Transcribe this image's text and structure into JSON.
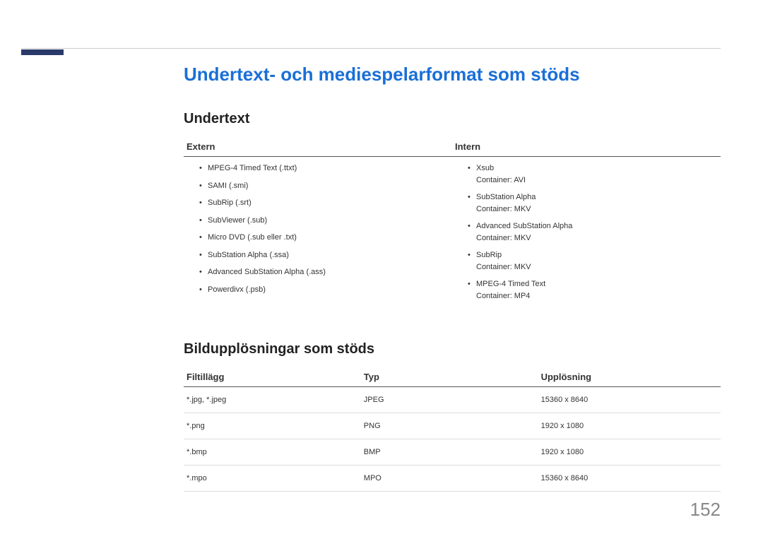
{
  "main_title": "Undertext- och mediespelarformat som stöds",
  "section1": {
    "title": "Undertext",
    "col_extern": "Extern",
    "col_intern": "Intern",
    "extern_items": [
      "MPEG-4 Timed Text (.ttxt)",
      "SAMI (.smi)",
      "SubRip (.srt)",
      "SubViewer (.sub)",
      "Micro DVD (.sub eller .txt)",
      "SubStation Alpha (.ssa)",
      "Advanced SubStation Alpha (.ass)",
      "Powerdivx (.psb)"
    ],
    "intern_items": [
      {
        "main": "Xsub",
        "sub": "Container: AVI"
      },
      {
        "main": "SubStation Alpha",
        "sub": "Container: MKV"
      },
      {
        "main": "Advanced SubStation Alpha",
        "sub": "Container: MKV"
      },
      {
        "main": "SubRip",
        "sub": "Container: MKV"
      },
      {
        "main": "MPEG-4 Timed Text",
        "sub": "Container: MP4"
      }
    ]
  },
  "section2": {
    "title": "Bildupplösningar som stöds",
    "headers": {
      "ext": "Filtillägg",
      "type": "Typ",
      "res": "Upplösning"
    },
    "rows": [
      {
        "ext": "*.jpg, *.jpeg",
        "type": "JPEG",
        "res": "15360 x 8640"
      },
      {
        "ext": "*.png",
        "type": "PNG",
        "res": "1920 x 1080"
      },
      {
        "ext": "*.bmp",
        "type": "BMP",
        "res": "1920 x 1080"
      },
      {
        "ext": "*.mpo",
        "type": "MPO",
        "res": "15360 x 8640"
      }
    ]
  },
  "page_number": "152"
}
